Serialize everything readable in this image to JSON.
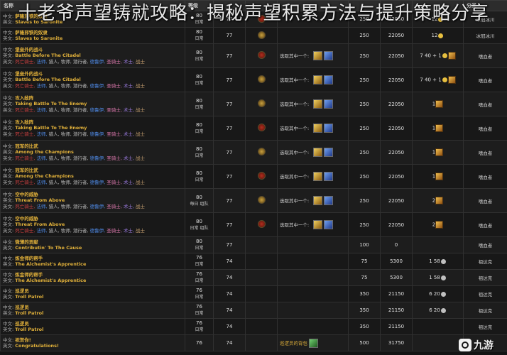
{
  "title": "十老爷声望铸就攻略：揭秘声望积累方法与提升策略分享",
  "columns": [
    "名称",
    "等级",
    "",
    "",
    "",
    "",
    "",
    "",
    "分类"
  ],
  "labels": {
    "zh_prefix": "中文:",
    "en_prefix": "英文:",
    "choose_one": "选取其中一个:"
  },
  "class_line": {
    "prefix": "英文:",
    "dk": "死亡骑士,",
    "shaman": "法师,",
    "hunter": "猎人,",
    "mid": "牧师,",
    "rogue": "潜行者,",
    "druid": "德鲁伊,",
    "paladin": "圣骑士,",
    "warlock": "术士,",
    "warrior": "战士"
  },
  "rows": [
    {
      "zh": "萨隆邪铁的奴隶",
      "en": "Slaves to Saronite",
      "lvl": "80",
      "tag": "日常",
      "req": "77",
      "faction": "horde",
      "reward": "",
      "icons": [],
      "v1": "250",
      "v2": "22050",
      "money": "12",
      "coin": "g",
      "pack": "",
      "cat": "冰冠冰川",
      "classes": false
    },
    {
      "zh": "萨隆邪铁的奴隶",
      "en": "Slaves to Saronite",
      "lvl": "80",
      "tag": "日常",
      "req": "77",
      "faction": "alliance",
      "reward": "",
      "icons": [],
      "v1": "250",
      "v2": "22050",
      "money": "12",
      "coin": "g",
      "pack": "",
      "cat": "冰冠冰川",
      "classes": false
    },
    {
      "zh": "堡垒外的战斗",
      "en": "Battle Before The Citadel",
      "lvl": "80",
      "tag": "日常",
      "req": "77",
      "faction": "horde",
      "reward": "选取其中一个:",
      "icons": [
        "gold",
        "blue"
      ],
      "v1": "250",
      "v2": "22050",
      "money": "7 40 + 1",
      "coin": "g",
      "pack": "yes",
      "cat": "嗜血者",
      "classes": true
    },
    {
      "zh": "堡垒外的战斗",
      "en": "Battle Before The Citadel",
      "lvl": "80",
      "tag": "日常",
      "req": "77",
      "faction": "alliance",
      "reward": "选取其中一个:",
      "icons": [
        "gold",
        "blue"
      ],
      "v1": "250",
      "v2": "22050",
      "money": "7 40 + 1",
      "coin": "g",
      "pack": "yes",
      "cat": "嗜血者",
      "classes": true
    },
    {
      "zh": "攻入敌阵",
      "en": "Taking Battle To The Enemy",
      "lvl": "80",
      "tag": "日常",
      "req": "77",
      "faction": "alliance",
      "reward": "选取其中一个:",
      "icons": [
        "gold",
        "blue"
      ],
      "v1": "250",
      "v2": "22050",
      "money": "1",
      "coin": "",
      "pack": "yes",
      "cat": "嗜血者",
      "classes": true
    },
    {
      "zh": "攻入敌阵",
      "en": "Taking Battle To The Enemy",
      "lvl": "80",
      "tag": "日常",
      "req": "77",
      "faction": "horde",
      "reward": "选取其中一个:",
      "icons": [
        "gold",
        "blue"
      ],
      "v1": "250",
      "v2": "22050",
      "money": "1",
      "coin": "",
      "pack": "yes",
      "cat": "嗜血者",
      "classes": true
    },
    {
      "zh": "冠军的比武",
      "en": "Among the Champions",
      "lvl": "80",
      "tag": "日常",
      "req": "77",
      "faction": "alliance",
      "reward": "选取其中一个:",
      "icons": [
        "gold",
        "blue"
      ],
      "v1": "250",
      "v2": "22050",
      "money": "1",
      "coin": "",
      "pack": "yes",
      "cat": "嗜血者",
      "classes": true
    },
    {
      "zh": "冠军的比武",
      "en": "Among the Champions",
      "lvl": "80",
      "tag": "日常",
      "req": "77",
      "faction": "horde",
      "reward": "选取其中一个:",
      "icons": [
        "gold",
        "blue"
      ],
      "v1": "250",
      "v2": "22050",
      "money": "1",
      "coin": "",
      "pack": "yes",
      "cat": "嗜血者",
      "classes": true
    },
    {
      "zh": "空中的威胁",
      "en": "Threat From Above",
      "lvl": "80",
      "tag": "每日 组队",
      "req": "77",
      "faction": "alliance",
      "reward": "选取其中一个:",
      "icons": [
        "gold",
        "blue"
      ],
      "v1": "250",
      "v2": "22050",
      "money": "2",
      "coin": "",
      "pack": "yes",
      "cat": "嗜血者",
      "classes": true
    },
    {
      "zh": "空中的威胁",
      "en": "Threat From Above",
      "lvl": "80",
      "tag": "日常 组队",
      "req": "77",
      "faction": "horde",
      "reward": "选取其中一个:",
      "icons": [
        "gold",
        "blue"
      ],
      "v1": "250",
      "v2": "22050",
      "money": "2",
      "coin": "",
      "pack": "yes",
      "cat": "嗜血者",
      "classes": true
    },
    {
      "zh": "微薄的贡献",
      "en": "Contributin' To The Cause",
      "lvl": "80",
      "tag": "日常",
      "req": "77",
      "faction": "",
      "reward": "",
      "icons": [],
      "v1": "100",
      "v2": "0",
      "money": "",
      "coin": "",
      "pack": "",
      "cat": "嗜血者",
      "classes": false
    },
    {
      "zh": "炼金师的帮手",
      "en": "The Alchemist's Apprentice",
      "lvl": "76",
      "tag": "日常",
      "req": "74",
      "faction": "",
      "reward": "",
      "icons": [],
      "v1": "75",
      "v2": "5300",
      "money": "1 58",
      "coin": "s",
      "pack": "",
      "cat": "祖达克",
      "classes": false
    },
    {
      "zh": "炼金师的帮手",
      "en": "The Alchemist's Apprentice",
      "lvl": "76",
      "tag": "日常",
      "req": "74",
      "faction": "",
      "reward": "",
      "icons": [],
      "v1": "75",
      "v2": "5300",
      "money": "1 58",
      "coin": "s",
      "pack": "",
      "cat": "祖达克",
      "classes": false
    },
    {
      "zh": "巡逻员",
      "en": "Troll Patrol",
      "lvl": "76",
      "tag": "日常",
      "req": "74",
      "faction": "",
      "reward": "",
      "icons": [],
      "v1": "350",
      "v2": "21150",
      "money": "6 20",
      "coin": "s",
      "pack": "",
      "cat": "祖达克",
      "classes": false
    },
    {
      "zh": "巡逻员",
      "en": "Troll Patrol",
      "lvl": "76",
      "tag": "日常",
      "req": "74",
      "faction": "",
      "reward": "",
      "icons": [],
      "v1": "350",
      "v2": "21150",
      "money": "6 20",
      "coin": "s",
      "pack": "",
      "cat": "祖达克",
      "classes": false
    },
    {
      "zh": "巡逻员",
      "en": "Troll Patrol",
      "lvl": "76",
      "tag": "日常",
      "req": "74",
      "faction": "",
      "reward": "",
      "icons": [],
      "v1": "350",
      "v2": "21150",
      "money": "",
      "coin": "",
      "pack": "",
      "cat": "祖达克",
      "classes": false
    },
    {
      "zh": "祝贺你!",
      "en": "Congratulations!",
      "lvl": "76",
      "tag": "",
      "req": "74",
      "faction": "",
      "reward": "巡逻员的背包",
      "icons": [
        "green"
      ],
      "v1": "500",
      "v2": "31750",
      "money": "",
      "coin": "",
      "pack": "",
      "cat": "",
      "classes": false
    }
  ],
  "watermark": {
    "text": "九游"
  }
}
